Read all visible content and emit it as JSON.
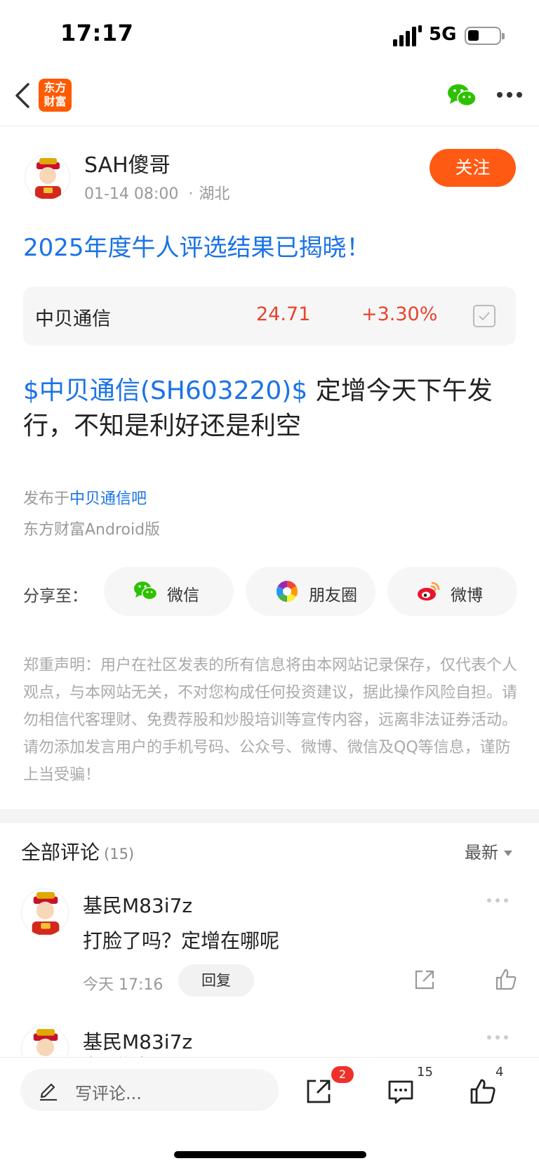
{
  "status_bar": {
    "time": "17:17",
    "network": "5G"
  },
  "nav": {
    "logo_text_line1": "东方",
    "logo_text_line2": "财富"
  },
  "author": {
    "name": "SAH傻哥",
    "datetime": "01-14 08:00",
    "location": "湖北",
    "follow_label": "关注"
  },
  "promo": "2025年度牛人评选结果已揭晓！",
  "stock": {
    "name": "中贝通信",
    "price": "24.71",
    "change": "+3.30%"
  },
  "post": {
    "tag": "$中贝通信(SH603220)$",
    "text": " 定增今天下午发行，不知是利好还是利空"
  },
  "meta": {
    "posted_in_prefix": "发布于",
    "posted_in_link": "中贝通信吧",
    "client": "东方财富Android版"
  },
  "share": {
    "label": "分享至：",
    "buttons": [
      {
        "label": "微信",
        "icon": "wechat-icon"
      },
      {
        "label": "朋友圈",
        "icon": "moments-icon"
      },
      {
        "label": "微博",
        "icon": "weibo-icon"
      }
    ]
  },
  "disclaimer": "郑重声明：用户在社区发表的所有信息将由本网站记录保存，仅代表个人观点，与本网站无关，不对您构成任何投资建议，据此操作风险自担。请勿相信代客理财、免费荐股和炒股培训等宣传内容，远离非法证券活动。请勿添加发言用户的手机号码、公众号、微博、微信及QQ等信息，谨防上当受骗！",
  "comments": {
    "title": "全部评论",
    "count": "(15)",
    "sort_label": "最新",
    "items": [
      {
        "user": "基民M83i7z",
        "text": "打脸了吗？定增在哪呢",
        "time": "今天 17:16",
        "reply_label": "回复"
      },
      {
        "user": "基民M83i7z",
        "sub": "今天 湖南"
      }
    ]
  },
  "bottom": {
    "placeholder": "写评论...",
    "share_badge": "2",
    "comment_count": "15",
    "like_count": "4"
  },
  "colors": {
    "accent": "#ff5a14",
    "link": "#1a73e8",
    "rise": "#e8432e"
  }
}
